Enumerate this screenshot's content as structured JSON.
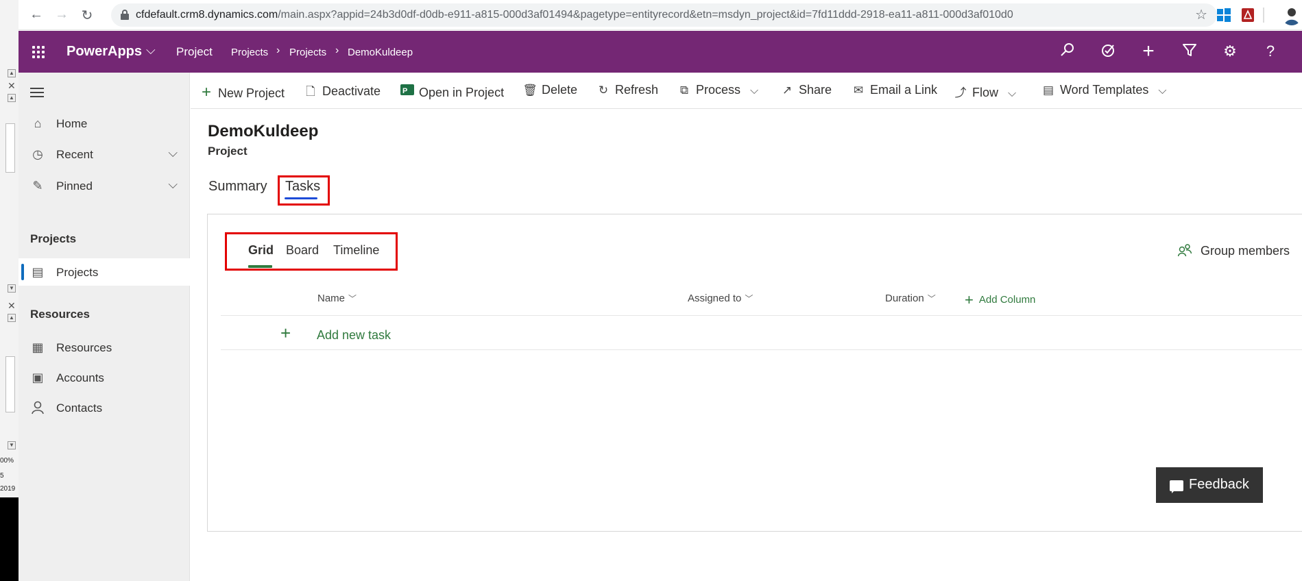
{
  "browser": {
    "url_host": "cfdefault.crm8.dynamics.com",
    "url_path": "/main.aspx?appid=24b3d0df-d0db-e911-a815-000d3af01494&pagetype=entityrecord&etn=msdyn_project&id=7fd11ddd-2918-ea11-a811-000d3af010d0",
    "icons": [
      "back-icon",
      "forward-icon",
      "reload-icon",
      "lock-icon",
      "star-icon"
    ]
  },
  "left_strip": {
    "texts": [
      "00%",
      "5",
      "2019"
    ]
  },
  "header": {
    "app_name": "PowerApps",
    "area": "Project",
    "breadcrumb": [
      "Projects",
      "Projects",
      "DemoKuldeep"
    ],
    "color": "#742774"
  },
  "sidebar": {
    "top_items": [
      {
        "label": "Home",
        "icon": "home-icon"
      },
      {
        "label": "Recent",
        "icon": "clock-icon"
      },
      {
        "label": "Pinned",
        "icon": "pin-icon"
      }
    ],
    "group1_title": "Projects",
    "group1_items": [
      {
        "label": "Projects",
        "icon": "projects-icon"
      }
    ],
    "group2_title": "Resources",
    "group2_items": [
      {
        "label": "Resources",
        "icon": "resources-icon"
      },
      {
        "label": "Accounts",
        "icon": "accounts-icon"
      },
      {
        "label": "Contacts",
        "icon": "contact-icon"
      }
    ]
  },
  "commands": {
    "new_project": "New Project",
    "deactivate": "Deactivate",
    "open_in_project": "Open in Project",
    "delete": "Delete",
    "refresh": "Refresh",
    "process": "Process",
    "share": "Share",
    "email_link": "Email a Link",
    "flow": "Flow",
    "word_templates": "Word Templates"
  },
  "record": {
    "title": "DemoKuldeep",
    "entity": "Project"
  },
  "tabs": {
    "summary": "Summary",
    "tasks": "Tasks",
    "selected": "Tasks"
  },
  "tasks_view": {
    "subtabs": [
      "Grid",
      "Board",
      "Timeline"
    ],
    "selected": "Grid",
    "group_members": "Group members",
    "columns": [
      "Name",
      "Assigned to",
      "Duration"
    ],
    "add_column": "Add Column",
    "add_new_task": "Add new task",
    "accent": "#307a3e"
  },
  "feedback": "Feedback"
}
